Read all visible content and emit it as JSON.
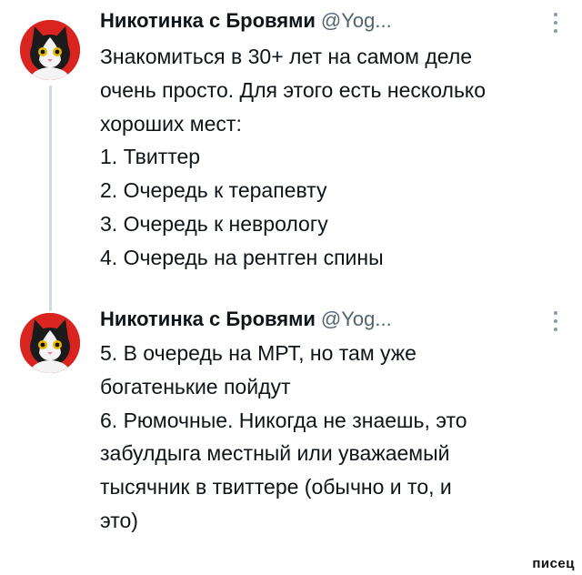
{
  "thread": [
    {
      "author": "Никотинка с Бровями",
      "handle": "@Yog...",
      "avatar_icon": "cat-avatar-icon",
      "more_icon": "more-options-icon",
      "lines": [
        "Знакомиться в 30+ лет на самом деле",
        "очень просто. Для этого есть несколько",
        "хороших мест:",
        "1. Твиттер",
        "2. Очередь к терапевту",
        "3. Очередь к неврологу",
        "4. Очередь на рентген спины"
      ]
    },
    {
      "author": "Никотинка с Бровями",
      "handle": "@Yog...",
      "avatar_icon": "cat-avatar-icon",
      "more_icon": "more-options-icon",
      "lines": [
        "5. В очередь на МРТ, но там уже",
        "богатенькие пойдут",
        "6. Рюмочные. Никогда не знаешь, это",
        "забулдыга местный или уважаемый",
        "тысячник в твиттере (обычно и то, и",
        "это)"
      ]
    }
  ],
  "watermark": "писец",
  "colors": {
    "avatar_bg": "#d9241f",
    "thread_line": "#cfd9de",
    "handle": "#536471",
    "text": "#0f1419"
  }
}
